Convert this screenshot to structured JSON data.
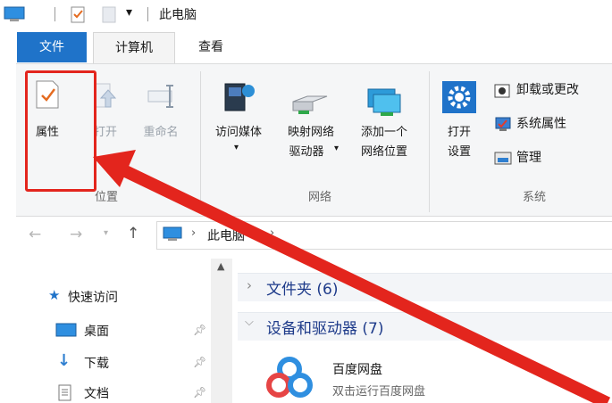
{
  "window": {
    "title": "此电脑"
  },
  "tabs": [
    {
      "label": "文件"
    },
    {
      "label": "计算机"
    },
    {
      "label": "查看"
    }
  ],
  "ribbon": {
    "location_group": {
      "label": "位置",
      "properties": "属性",
      "open": "打开",
      "rename": "重命名"
    },
    "network_group": {
      "label": "网络",
      "access_media": "访问媒体",
      "map_drive_line1": "映射网络",
      "map_drive_line2": "驱动器",
      "add_location_line1": "添加一个",
      "add_location_line2": "网络位置"
    },
    "system_group": {
      "label": "系统",
      "open_settings_line1": "打开",
      "open_settings_line2": "设置",
      "uninstall": "卸载或更改",
      "sys_properties": "系统属性",
      "manage": "管理"
    }
  },
  "navigation": {
    "address_segment": "此电脑",
    "separator": "›"
  },
  "sidebar": {
    "items": [
      {
        "label": "快速访问"
      },
      {
        "label": "桌面"
      },
      {
        "label": "下载"
      },
      {
        "label": "文档"
      }
    ]
  },
  "content": {
    "folders_header": "文件夹 (6)",
    "devices_header": "设备和驱动器 (7)",
    "drive_item": {
      "name": "百度网盘",
      "description": "双击运行百度网盘"
    }
  },
  "colors": {
    "accent": "#1f73c9",
    "annotation_red": "#e3251d"
  }
}
